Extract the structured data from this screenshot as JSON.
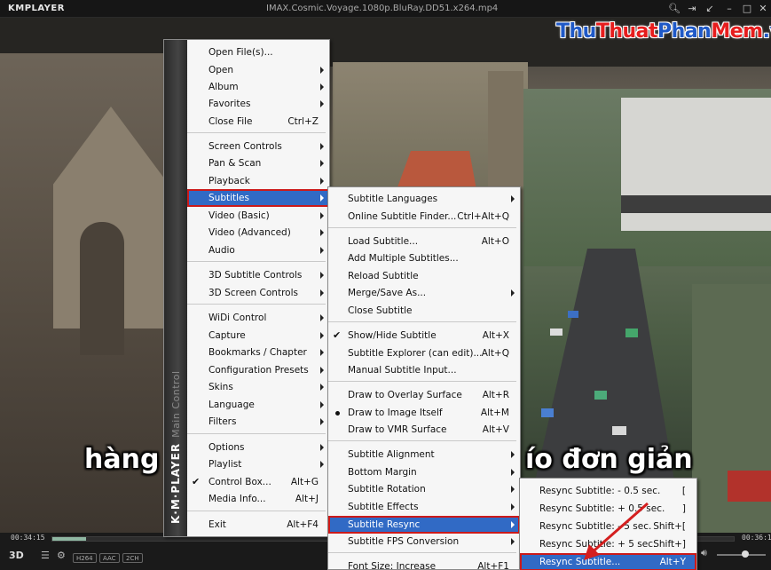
{
  "window": {
    "app_name": "KMPLAYER",
    "title": "IMAX.Cosmic.Voyage.1080p.BluRay.DD51.x264.mp4",
    "watermark_parts": [
      "Thu",
      "Thuat",
      "Phan",
      "Mem",
      ".vn"
    ],
    "watermark_colors": [
      "#1f59c7",
      "#e61d1d",
      "#1f59c7",
      "#e61d1d",
      "#1f59c7"
    ]
  },
  "video": {
    "subtitle_left": "hàng",
    "subtitle_right": "ío đơn giản"
  },
  "player_bar": {
    "elapsed": "00:34:15",
    "total": "00:36:1",
    "progress": 0.05,
    "badges": [
      "H264",
      "AAC",
      "2CH"
    ],
    "mode_label": "3D"
  },
  "main_menu": {
    "strip_title": "K·M·PLAYER",
    "strip_subtitle": "Main Control",
    "items": [
      {
        "label": "Open File(s)...",
        "shortcut": "",
        "submenu": false
      },
      {
        "label": "Open",
        "shortcut": "",
        "submenu": true
      },
      {
        "label": "Album",
        "shortcut": "",
        "submenu": true
      },
      {
        "label": "Favorites",
        "shortcut": "",
        "submenu": true
      },
      {
        "label": "Close File",
        "shortcut": "Ctrl+Z",
        "submenu": false
      },
      {
        "label": "Screen Controls",
        "shortcut": "",
        "submenu": true
      },
      {
        "label": "Pan & Scan",
        "shortcut": "",
        "submenu": true
      },
      {
        "label": "Playback",
        "shortcut": "",
        "submenu": true
      },
      {
        "label": "Subtitles",
        "shortcut": "",
        "submenu": true
      },
      {
        "label": "Video (Basic)",
        "shortcut": "",
        "submenu": true
      },
      {
        "label": "Video (Advanced)",
        "shortcut": "",
        "submenu": true
      },
      {
        "label": "Audio",
        "shortcut": "",
        "submenu": true
      },
      {
        "label": "3D Subtitle Controls",
        "shortcut": "",
        "submenu": true
      },
      {
        "label": "3D Screen Controls",
        "shortcut": "",
        "submenu": true
      },
      {
        "label": "WiDi Control",
        "shortcut": "",
        "submenu": true
      },
      {
        "label": "Capture",
        "shortcut": "",
        "submenu": true
      },
      {
        "label": "Bookmarks / Chapter",
        "shortcut": "",
        "submenu": true
      },
      {
        "label": "Configuration Presets",
        "shortcut": "",
        "submenu": true
      },
      {
        "label": "Skins",
        "shortcut": "",
        "submenu": true
      },
      {
        "label": "Language",
        "shortcut": "",
        "submenu": true
      },
      {
        "label": "Filters",
        "shortcut": "",
        "submenu": true
      },
      {
        "label": "Options",
        "shortcut": "",
        "submenu": true
      },
      {
        "label": "Playlist",
        "shortcut": "",
        "submenu": true
      },
      {
        "label": "Control Box...",
        "shortcut": "Alt+G",
        "submenu": false,
        "checked": true
      },
      {
        "label": "Media Info...",
        "shortcut": "Alt+J",
        "submenu": false
      },
      {
        "label": "Exit",
        "shortcut": "Alt+F4",
        "submenu": false
      }
    ]
  },
  "subtitles_menu": {
    "items": [
      {
        "label": "Subtitle Languages",
        "shortcut": "",
        "submenu": true
      },
      {
        "label": "Online Subtitle Finder...",
        "shortcut": "Ctrl+Alt+Q",
        "submenu": false
      },
      {
        "label": "Load Subtitle...",
        "shortcut": "Alt+O",
        "submenu": false
      },
      {
        "label": "Add Multiple Subtitles...",
        "shortcut": "",
        "submenu": false
      },
      {
        "label": "Reload Subtitle",
        "shortcut": "",
        "submenu": false
      },
      {
        "label": "Merge/Save As...",
        "shortcut": "",
        "submenu": true
      },
      {
        "label": "Close Subtitle",
        "shortcut": "",
        "submenu": false
      },
      {
        "label": "Show/Hide Subtitle",
        "shortcut": "Alt+X",
        "submenu": false,
        "checked": true
      },
      {
        "label": "Subtitle Explorer (can edit)...",
        "shortcut": "Alt+Q",
        "submenu": false
      },
      {
        "label": "Manual Subtitle Input...",
        "shortcut": "",
        "submenu": false
      },
      {
        "label": "Draw to Overlay Surface",
        "shortcut": "Alt+R",
        "submenu": false
      },
      {
        "label": "Draw to Image Itself",
        "shortcut": "Alt+M",
        "submenu": false,
        "radio": true
      },
      {
        "label": "Draw to VMR Surface",
        "shortcut": "Alt+V",
        "submenu": false
      },
      {
        "label": "Subtitle Alignment",
        "shortcut": "",
        "submenu": true
      },
      {
        "label": "Bottom Margin",
        "shortcut": "",
        "submenu": true
      },
      {
        "label": "Subtitle Rotation",
        "shortcut": "",
        "submenu": true
      },
      {
        "label": "Subtitle Effects",
        "shortcut": "",
        "submenu": true
      },
      {
        "label": "Subtitle Resync",
        "shortcut": "",
        "submenu": true
      },
      {
        "label": "Subtitle FPS Conversion",
        "shortcut": "",
        "submenu": true
      },
      {
        "label": "Font Size: Increase",
        "shortcut": "Alt+F1",
        "submenu": false
      }
    ]
  },
  "resync_menu": {
    "items": [
      {
        "label": "Resync Subtitle: - 0.5 sec.",
        "shortcut": "["
      },
      {
        "label": "Resync Subtitle: + 0.5 sec.",
        "shortcut": "]"
      },
      {
        "label": "Resync Subtitle: - 5 sec.",
        "shortcut": "Shift+["
      },
      {
        "label": "Resync Subtitle: + 5 sec.",
        "shortcut": "Shift+]"
      },
      {
        "label": "Resync Subtitle...",
        "shortcut": "Alt+Y"
      }
    ]
  }
}
